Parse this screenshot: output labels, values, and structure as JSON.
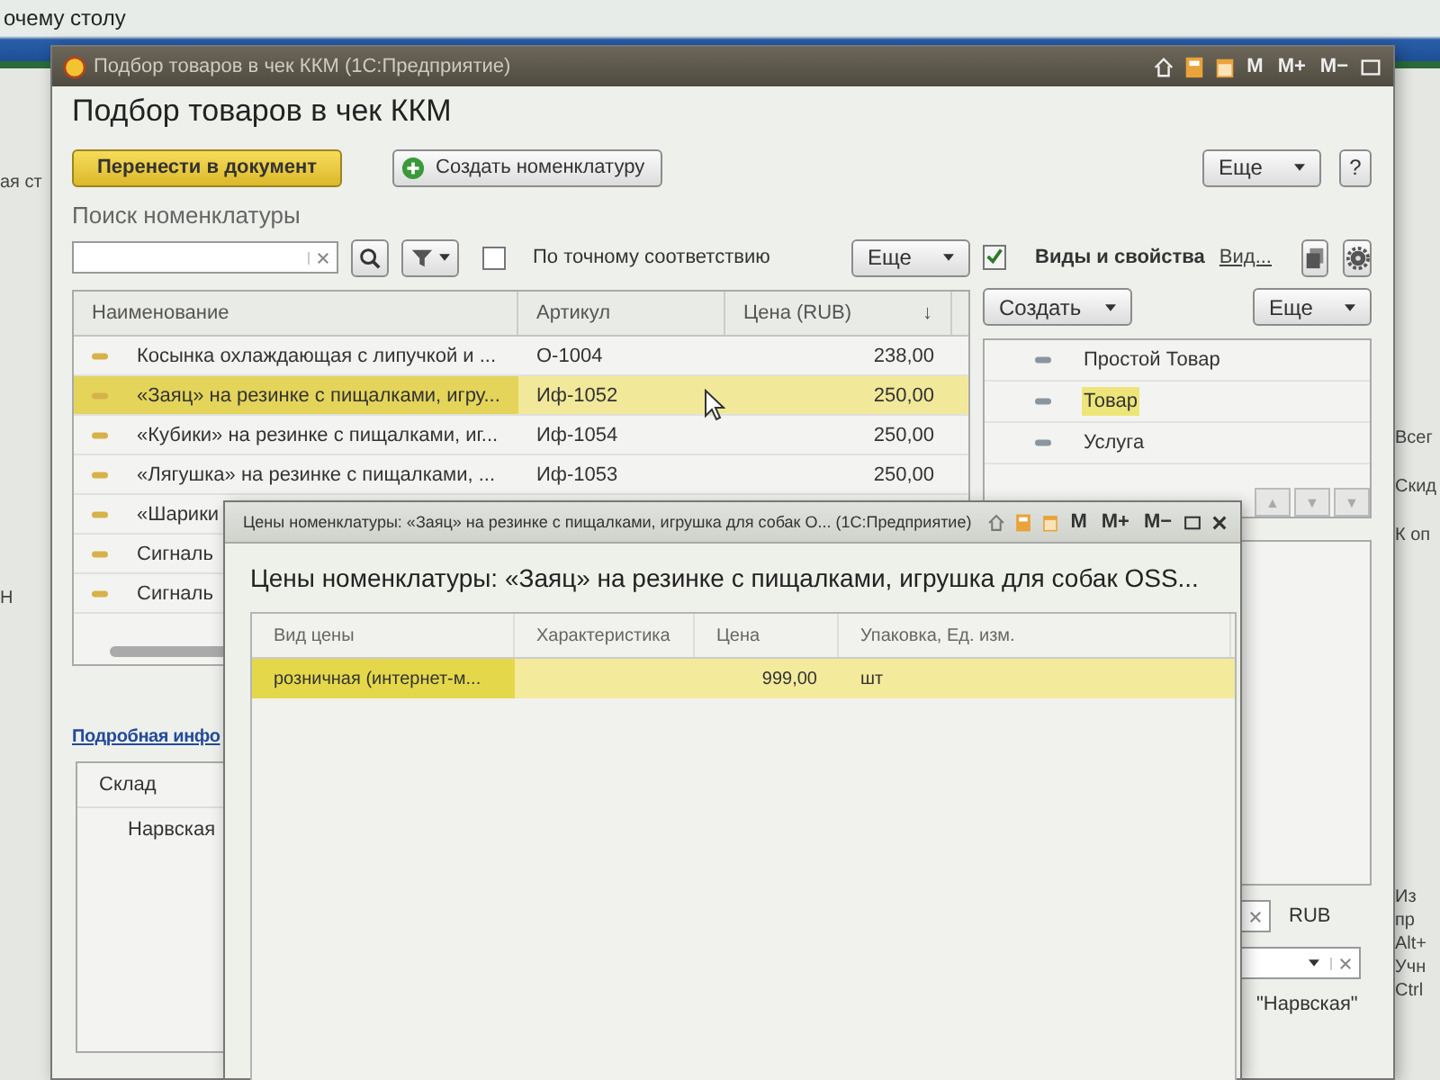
{
  "desktop": {
    "caption": "очему столу",
    "left_fragments": [
      "ая ст",
      "Н"
    ],
    "right_fragments": [
      "Всег",
      "Скид",
      "К оп"
    ],
    "right_bottom_fragments": [
      "Из",
      "пр",
      "Alt+",
      "Учн",
      "Ctrl"
    ]
  },
  "main_window": {
    "title": "Подбор товаров в чек ККМ  (1С:Предприятие)",
    "memory_buttons": [
      "M",
      "M+",
      "M−"
    ],
    "heading": "Подбор товаров в чек ККМ",
    "primary_button": "Перенести в документ",
    "create_button": "Создать номенклатуру",
    "more_button": "Еще",
    "help_button": "?",
    "search_label": "Поиск номенклатуры",
    "exact_match": {
      "label": "По точному соответствию",
      "checked": false
    },
    "search_more_button": "Еще",
    "table": {
      "columns": [
        {
          "label": "Наименование"
        },
        {
          "label": "Артикул"
        },
        {
          "label": "Цена (RUB)",
          "sort_mark": "↓"
        }
      ],
      "rows": [
        {
          "name": "Косынка охлаждающая с липучкой и ...",
          "article": "О-1004",
          "price": "238,00",
          "selected": false
        },
        {
          "name": "«Заяц» на резинке с пищалками, игру...",
          "article": "Иф-1052",
          "price": "250,00",
          "selected": true
        },
        {
          "name": "«Кубики» на резинке с пищалками, иг...",
          "article": "Иф-1054",
          "price": "250,00",
          "selected": false
        },
        {
          "name": "«Лягушка» на резинке с пищалками, ...",
          "article": "Иф-1053",
          "price": "250,00",
          "selected": false
        },
        {
          "name": "«Шарики",
          "selected": false
        },
        {
          "name": "Сигналь",
          "selected": false
        },
        {
          "name": "Сигналь",
          "selected": false
        }
      ]
    },
    "kinds_panel": {
      "label": "Виды и свойства",
      "checked": true,
      "link": "Вид...",
      "create_button": "Создать",
      "more_button": "Еще",
      "items": [
        {
          "label": "Простой Товар",
          "selected": false
        },
        {
          "label": "Товар",
          "selected": true
        },
        {
          "label": "Услуга",
          "selected": false
        }
      ],
      "nav_buttons": [
        "▲",
        "▼",
        "▼"
      ]
    },
    "details_link": "Подробная инфо",
    "stock_table": {
      "column": "Склад",
      "rows": [
        "Нарвская"
      ]
    },
    "currency": "RUB",
    "warehouse_note": "\"Нарвская\""
  },
  "dialog": {
    "title": "Цены номенклатуры: «Заяц» на резинке с пищалками, игрушка для собак О...  (1С:Предприятие)",
    "memory_buttons": [
      "M",
      "M+",
      "M−"
    ],
    "heading": "Цены номенклатуры: «Заяц» на резинке с пищалками, игрушка для собак OSS...",
    "columns": [
      "Вид цены",
      "Характеристика",
      "Цена",
      "Упаковка, Ед. изм."
    ],
    "rows": [
      {
        "price_type": "розничная (интернет-м...",
        "price": "999,00",
        "unit": "шт",
        "selected": true
      }
    ]
  }
}
